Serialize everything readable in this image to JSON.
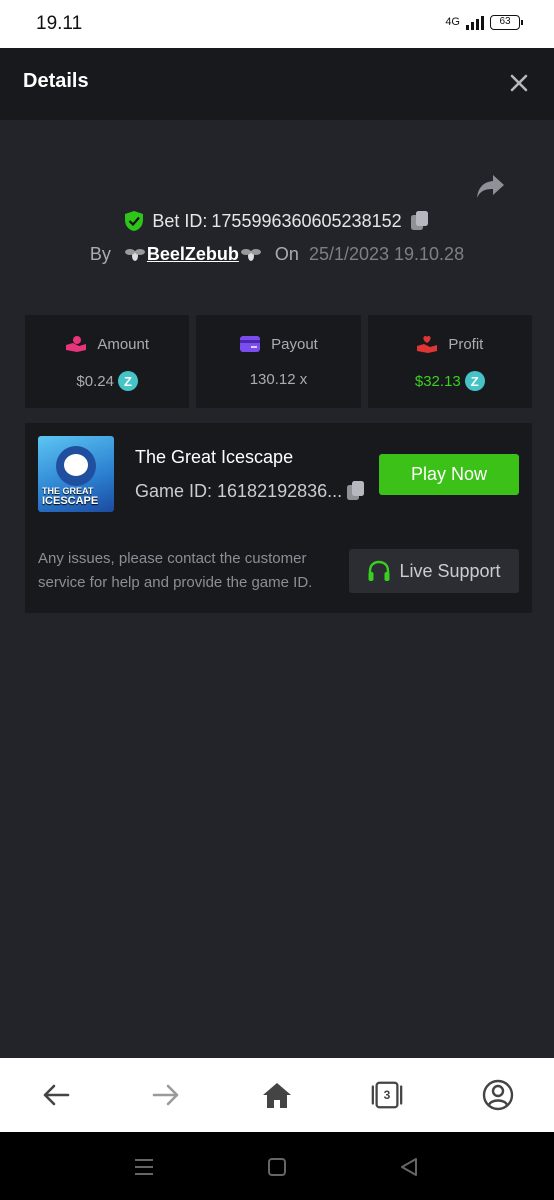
{
  "status_bar": {
    "time": "19.11",
    "network": "4G",
    "battery": "63"
  },
  "header": {
    "title": "Details"
  },
  "bet": {
    "label": "Bet ID:",
    "id": "1755996360605238152"
  },
  "meta": {
    "by_label": "By",
    "username": "BeelZebub",
    "on_label": "On",
    "date": "25/1/2023 19.10.28"
  },
  "stats": [
    {
      "label": "Amount",
      "value": "$0.24",
      "icon": "hand-coin-icon",
      "accent": "#e8347a"
    },
    {
      "label": "Payout",
      "value": "130.12 x",
      "icon": "card-icon",
      "accent": "#7b4cf0"
    },
    {
      "label": "Profit",
      "value": "$32.13",
      "icon": "hand-heart-icon",
      "accent": "#e03535"
    }
  ],
  "game": {
    "thumb_text_line1": "THE GREAT",
    "thumb_text_line2": "ICESCAPE",
    "name": "The Great Icescape",
    "id_label": "Game ID: 16182192836...",
    "play_label": "Play Now",
    "issue_text": "Any issues, please contact the customer service for help and provide the game ID.",
    "support_label": "Live Support"
  },
  "browser_nav": {
    "tabs_count": "3"
  },
  "colors": {
    "accent_green": "#3bc117",
    "coin": "#45c3c6",
    "profit_green": "#38cf20"
  }
}
